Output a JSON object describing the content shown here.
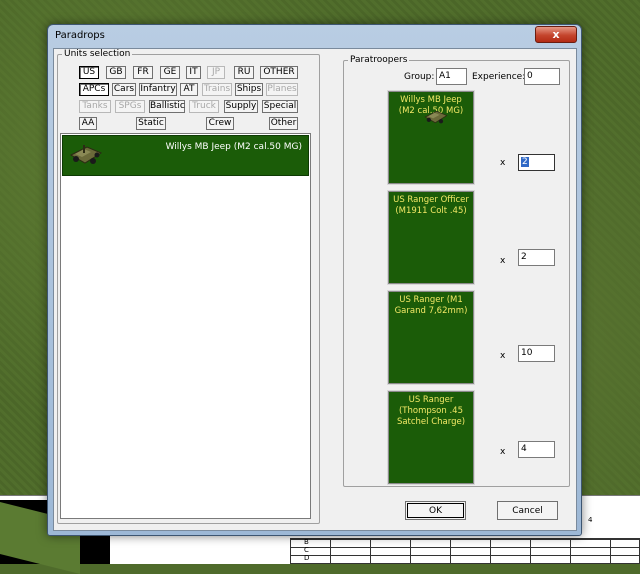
{
  "window": {
    "title": "Paradrops",
    "close_label": "x"
  },
  "units_selection": {
    "legend": "Units selection",
    "nations": [
      "US",
      "GB",
      "FR",
      "GE",
      "IT",
      "JP",
      "RU",
      "OTHER"
    ],
    "types_row1": [
      "APCs",
      "Cars",
      "Infantry",
      "AT",
      "Trains",
      "Ships",
      "Planes"
    ],
    "types_row2": [
      "Tanks",
      "SPGs",
      "Ballistic",
      "Truck",
      "Supply",
      "Special"
    ],
    "types_row3": [
      "AA",
      "Static",
      "Crew",
      "Other"
    ],
    "list": [
      {
        "label": "Willys MB Jeep (M2 cal.50 MG)"
      }
    ]
  },
  "paratroopers": {
    "legend": "Paratroopers",
    "group_label": "Group:",
    "group_value": "A1",
    "experience_label": "Experience:",
    "experience_value": "0",
    "times": "x",
    "slots": [
      {
        "label": "Willys MB Jeep (M2 cal.50 MG)",
        "count": "2"
      },
      {
        "label": "US Ranger Officer (M1911 Colt .45)",
        "count": "2"
      },
      {
        "label": "US Ranger (M1 Garand 7,62mm)",
        "count": "10"
      },
      {
        "label": "US Ranger (Thompson .45 Satchel Charge)",
        "count": "4"
      }
    ]
  },
  "buttons": {
    "ok": "OK",
    "cancel": "Cancel"
  },
  "map": {
    "grid_labels": [
      "B",
      "C",
      "D"
    ],
    "number": "4"
  },
  "colors": {
    "unit_bg": "#1b5c08",
    "slot_text": "#f2e866",
    "close": "#c4452d"
  }
}
